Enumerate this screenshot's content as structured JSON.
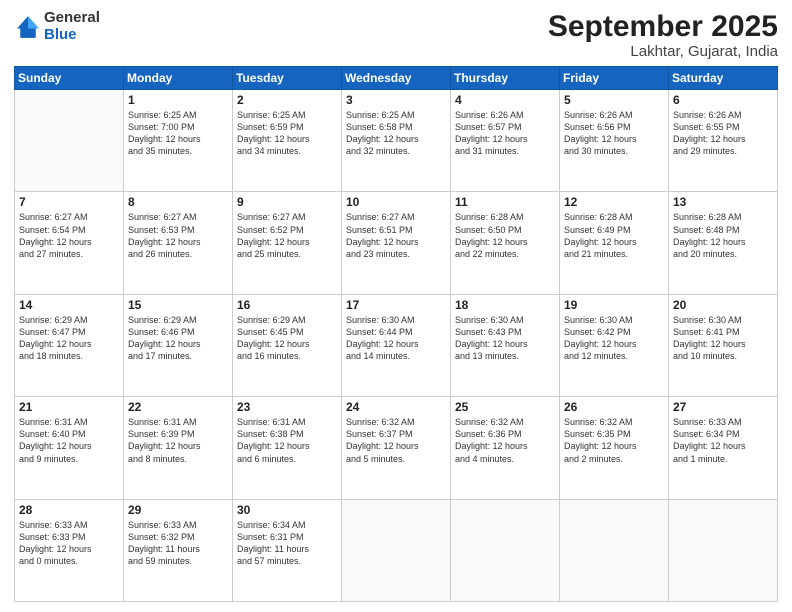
{
  "header": {
    "logo_general": "General",
    "logo_blue": "Blue",
    "month": "September 2025",
    "location": "Lakhtar, Gujarat, India"
  },
  "days_of_week": [
    "Sunday",
    "Monday",
    "Tuesday",
    "Wednesday",
    "Thursday",
    "Friday",
    "Saturday"
  ],
  "weeks": [
    [
      {
        "day": "",
        "info": ""
      },
      {
        "day": "1",
        "info": "Sunrise: 6:25 AM\nSunset: 7:00 PM\nDaylight: 12 hours\nand 35 minutes."
      },
      {
        "day": "2",
        "info": "Sunrise: 6:25 AM\nSunset: 6:59 PM\nDaylight: 12 hours\nand 34 minutes."
      },
      {
        "day": "3",
        "info": "Sunrise: 6:25 AM\nSunset: 6:58 PM\nDaylight: 12 hours\nand 32 minutes."
      },
      {
        "day": "4",
        "info": "Sunrise: 6:26 AM\nSunset: 6:57 PM\nDaylight: 12 hours\nand 31 minutes."
      },
      {
        "day": "5",
        "info": "Sunrise: 6:26 AM\nSunset: 6:56 PM\nDaylight: 12 hours\nand 30 minutes."
      },
      {
        "day": "6",
        "info": "Sunrise: 6:26 AM\nSunset: 6:55 PM\nDaylight: 12 hours\nand 29 minutes."
      }
    ],
    [
      {
        "day": "7",
        "info": "Sunrise: 6:27 AM\nSunset: 6:54 PM\nDaylight: 12 hours\nand 27 minutes."
      },
      {
        "day": "8",
        "info": "Sunrise: 6:27 AM\nSunset: 6:53 PM\nDaylight: 12 hours\nand 26 minutes."
      },
      {
        "day": "9",
        "info": "Sunrise: 6:27 AM\nSunset: 6:52 PM\nDaylight: 12 hours\nand 25 minutes."
      },
      {
        "day": "10",
        "info": "Sunrise: 6:27 AM\nSunset: 6:51 PM\nDaylight: 12 hours\nand 23 minutes."
      },
      {
        "day": "11",
        "info": "Sunrise: 6:28 AM\nSunset: 6:50 PM\nDaylight: 12 hours\nand 22 minutes."
      },
      {
        "day": "12",
        "info": "Sunrise: 6:28 AM\nSunset: 6:49 PM\nDaylight: 12 hours\nand 21 minutes."
      },
      {
        "day": "13",
        "info": "Sunrise: 6:28 AM\nSunset: 6:48 PM\nDaylight: 12 hours\nand 20 minutes."
      }
    ],
    [
      {
        "day": "14",
        "info": "Sunrise: 6:29 AM\nSunset: 6:47 PM\nDaylight: 12 hours\nand 18 minutes."
      },
      {
        "day": "15",
        "info": "Sunrise: 6:29 AM\nSunset: 6:46 PM\nDaylight: 12 hours\nand 17 minutes."
      },
      {
        "day": "16",
        "info": "Sunrise: 6:29 AM\nSunset: 6:45 PM\nDaylight: 12 hours\nand 16 minutes."
      },
      {
        "day": "17",
        "info": "Sunrise: 6:30 AM\nSunset: 6:44 PM\nDaylight: 12 hours\nand 14 minutes."
      },
      {
        "day": "18",
        "info": "Sunrise: 6:30 AM\nSunset: 6:43 PM\nDaylight: 12 hours\nand 13 minutes."
      },
      {
        "day": "19",
        "info": "Sunrise: 6:30 AM\nSunset: 6:42 PM\nDaylight: 12 hours\nand 12 minutes."
      },
      {
        "day": "20",
        "info": "Sunrise: 6:30 AM\nSunset: 6:41 PM\nDaylight: 12 hours\nand 10 minutes."
      }
    ],
    [
      {
        "day": "21",
        "info": "Sunrise: 6:31 AM\nSunset: 6:40 PM\nDaylight: 12 hours\nand 9 minutes."
      },
      {
        "day": "22",
        "info": "Sunrise: 6:31 AM\nSunset: 6:39 PM\nDaylight: 12 hours\nand 8 minutes."
      },
      {
        "day": "23",
        "info": "Sunrise: 6:31 AM\nSunset: 6:38 PM\nDaylight: 12 hours\nand 6 minutes."
      },
      {
        "day": "24",
        "info": "Sunrise: 6:32 AM\nSunset: 6:37 PM\nDaylight: 12 hours\nand 5 minutes."
      },
      {
        "day": "25",
        "info": "Sunrise: 6:32 AM\nSunset: 6:36 PM\nDaylight: 12 hours\nand 4 minutes."
      },
      {
        "day": "26",
        "info": "Sunrise: 6:32 AM\nSunset: 6:35 PM\nDaylight: 12 hours\nand 2 minutes."
      },
      {
        "day": "27",
        "info": "Sunrise: 6:33 AM\nSunset: 6:34 PM\nDaylight: 12 hours\nand 1 minute."
      }
    ],
    [
      {
        "day": "28",
        "info": "Sunrise: 6:33 AM\nSunset: 6:33 PM\nDaylight: 12 hours\nand 0 minutes."
      },
      {
        "day": "29",
        "info": "Sunrise: 6:33 AM\nSunset: 6:32 PM\nDaylight: 11 hours\nand 59 minutes."
      },
      {
        "day": "30",
        "info": "Sunrise: 6:34 AM\nSunset: 6:31 PM\nDaylight: 11 hours\nand 57 minutes."
      },
      {
        "day": "",
        "info": ""
      },
      {
        "day": "",
        "info": ""
      },
      {
        "day": "",
        "info": ""
      },
      {
        "day": "",
        "info": ""
      }
    ]
  ]
}
